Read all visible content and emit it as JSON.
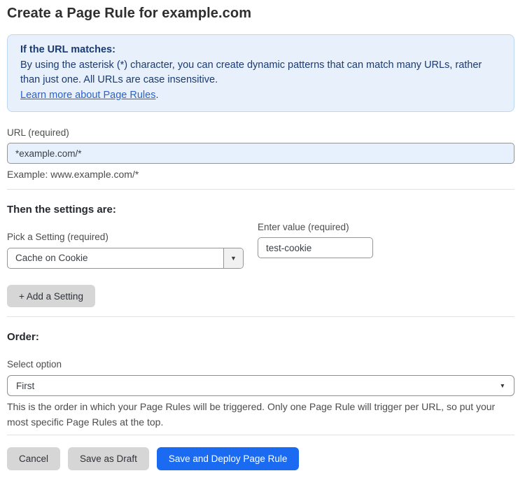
{
  "page": {
    "title": "Create a Page Rule for example.com"
  },
  "info_box": {
    "heading": "If the URL matches:",
    "body": "By using the asterisk (*) character, you can create dynamic patterns that can match many URLs, rather than just one. All URLs are case insensitive.",
    "link_text": "Learn more about Page Rules",
    "link_suffix": "."
  },
  "url_field": {
    "label": "URL (required)",
    "value": "*example.com/*",
    "hint": "Example: www.example.com/*"
  },
  "settings": {
    "heading": "Then the settings are:",
    "setting_label": "Pick a Setting (required)",
    "setting_selected": "Cache on Cookie",
    "value_label": "Enter value (required)",
    "value": "test-cookie",
    "add_button_label": "+ Add a Setting"
  },
  "order": {
    "heading": "Order:",
    "select_label": "Select option",
    "selected_option": "First",
    "description": "This is the order in which your Page Rules will be triggered. Only one Page Rule will trigger per URL, so put your most specific Page Rules at the top."
  },
  "footer": {
    "cancel_label": "Cancel",
    "save_draft_label": "Save as Draft",
    "save_deploy_label": "Save and Deploy Page Rule"
  },
  "icons": {
    "dropdown_arrow": "▼"
  },
  "colors": {
    "accent_blue": "#1a6bf2",
    "info_box_bg": "#e8f1fb",
    "info_box_border": "#bcd7f1",
    "info_text": "#1a3a70",
    "link_blue": "#2d62c8",
    "url_input_bg": "#e7f0fd",
    "gray_button_bg": "#d6d6d6"
  }
}
